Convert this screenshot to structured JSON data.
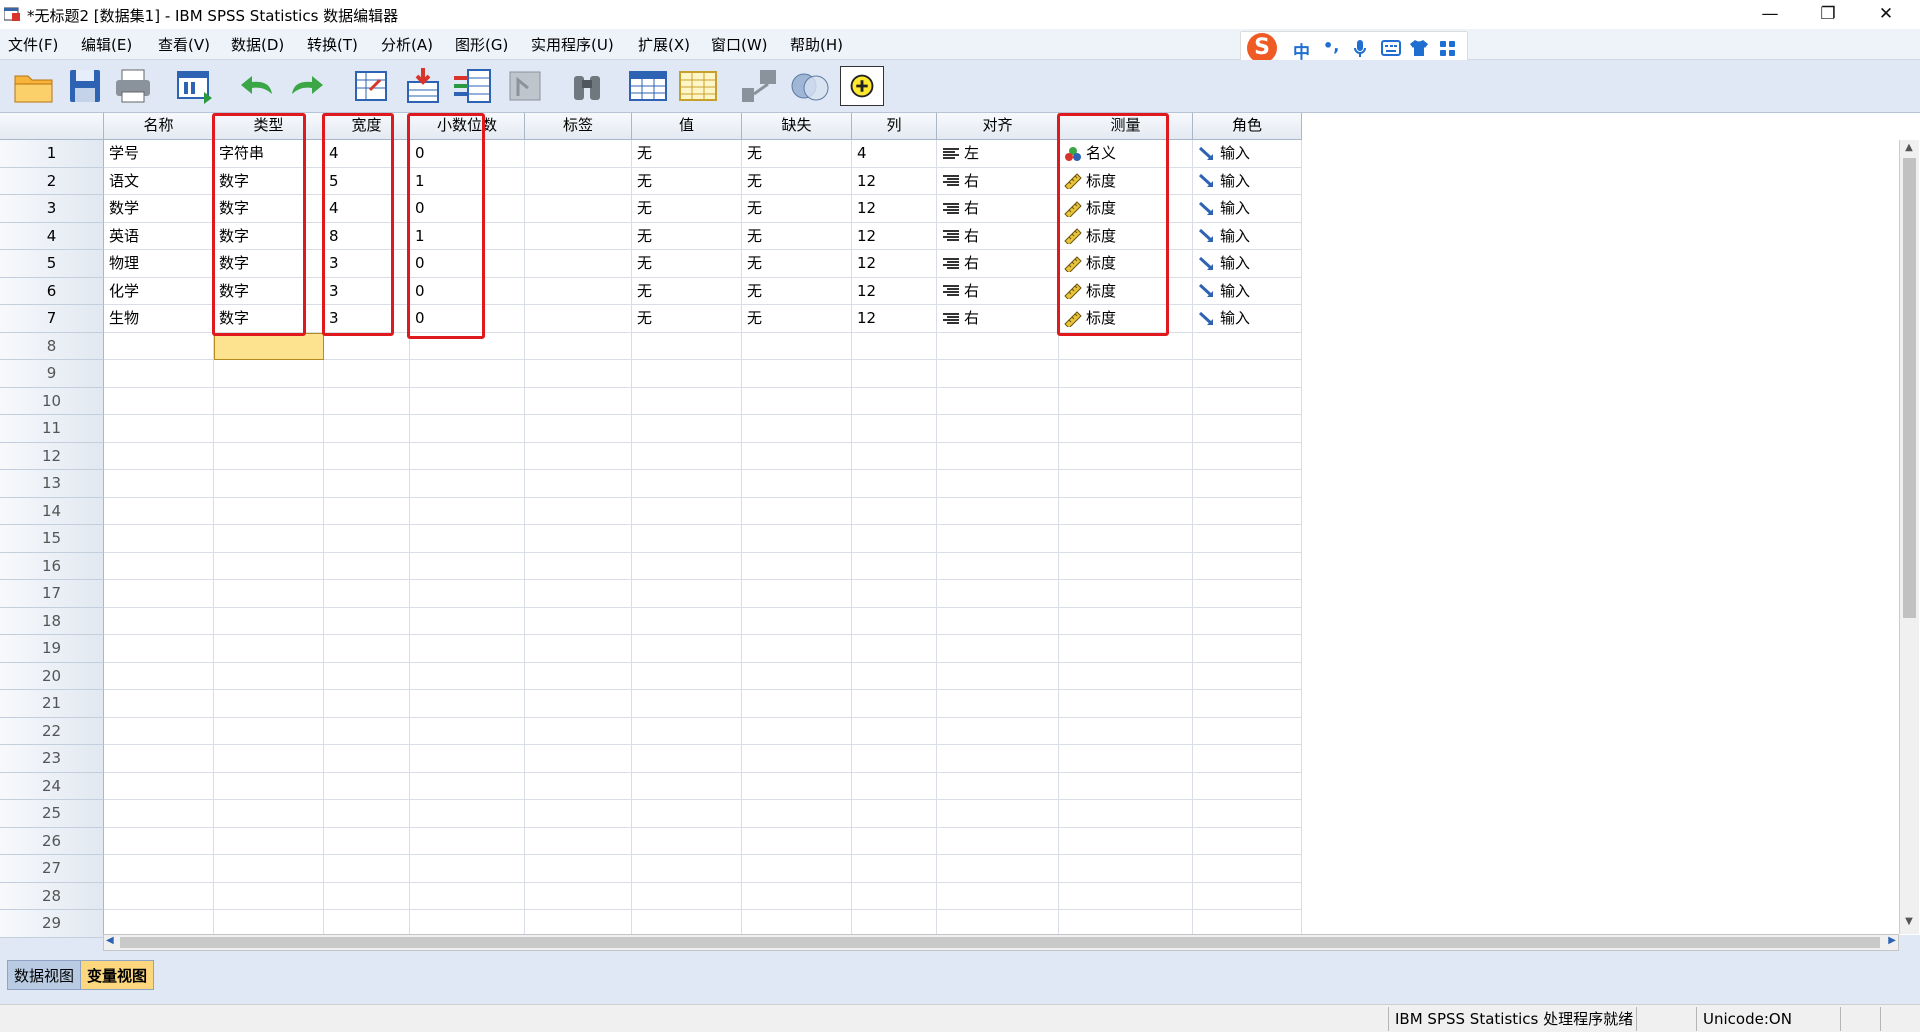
{
  "window": {
    "title": "*无标题2 [数据集1] - IBM SPSS Statistics 数据编辑器",
    "minimize": "—",
    "restore": "❐",
    "close": "✕"
  },
  "menu": [
    "文件(F)",
    "编辑(E)",
    "查看(V)",
    "数据(D)",
    "转换(T)",
    "分析(A)",
    "图形(G)",
    "实用程序(U)",
    "扩展(X)",
    "窗口(W)",
    "帮助(H)"
  ],
  "ime": {
    "logo": "S",
    "mode": "中",
    "punct": "•,"
  },
  "toolbar_icons": [
    "open-folder-icon",
    "save-icon",
    "print-icon",
    "recall-dialog-icon",
    "undo-icon",
    "redo-icon",
    "goto-case-icon",
    "goto-variable-icon",
    "variables-icon",
    "run-descriptives-icon",
    "find-icon",
    "insert-cases-icon",
    "insert-variable-icon",
    "split-file-icon",
    "weight-cases-icon",
    "select-cases-icon",
    "value-labels-icon"
  ],
  "grid": {
    "columns": [
      "名称",
      "类型",
      "宽度",
      "小数位数",
      "标签",
      "值",
      "缺失",
      "列",
      "对齐",
      "测量",
      "角色"
    ],
    "rows": [
      {
        "num": "1",
        "name": "学号",
        "type": "字符串",
        "width": "4",
        "decimals": "0",
        "label": "",
        "values": "无",
        "missing": "无",
        "columns": "4",
        "align": "左",
        "measure": "名义",
        "role": "输入"
      },
      {
        "num": "2",
        "name": "语文",
        "type": "数字",
        "width": "5",
        "decimals": "1",
        "label": "",
        "values": "无",
        "missing": "无",
        "columns": "12",
        "align": "右",
        "measure": "标度",
        "role": "输入"
      },
      {
        "num": "3",
        "name": "数学",
        "type": "数字",
        "width": "4",
        "decimals": "0",
        "label": "",
        "values": "无",
        "missing": "无",
        "columns": "12",
        "align": "右",
        "measure": "标度",
        "role": "输入"
      },
      {
        "num": "4",
        "name": "英语",
        "type": "数字",
        "width": "8",
        "decimals": "1",
        "label": "",
        "values": "无",
        "missing": "无",
        "columns": "12",
        "align": "右",
        "measure": "标度",
        "role": "输入"
      },
      {
        "num": "5",
        "name": "物理",
        "type": "数字",
        "width": "3",
        "decimals": "0",
        "label": "",
        "values": "无",
        "missing": "无",
        "columns": "12",
        "align": "右",
        "measure": "标度",
        "role": "输入"
      },
      {
        "num": "6",
        "name": "化学",
        "type": "数字",
        "width": "3",
        "decimals": "0",
        "label": "",
        "values": "无",
        "missing": "无",
        "columns": "12",
        "align": "右",
        "measure": "标度",
        "role": "输入"
      },
      {
        "num": "7",
        "name": "生物",
        "type": "数字",
        "width": "3",
        "decimals": "0",
        "label": "",
        "values": "无",
        "missing": "无",
        "columns": "12",
        "align": "右",
        "measure": "标度",
        "role": "输入"
      }
    ],
    "empty_rows": [
      "8",
      "9",
      "10",
      "11",
      "12",
      "13",
      "14",
      "15",
      "16",
      "17",
      "18",
      "19",
      "20",
      "21",
      "22",
      "23",
      "24",
      "25",
      "26",
      "27",
      "28",
      "29"
    ],
    "selected_cell": {
      "row": "8",
      "column": "类型"
    }
  },
  "tabs": [
    {
      "label": "数据视图",
      "active": false
    },
    {
      "label": "变量视图",
      "active": true
    }
  ],
  "status": {
    "processor": "IBM SPSS Statistics 处理程序就绪",
    "unicode": "Unicode:ON"
  },
  "colors": {
    "highlight_box": "#e0191f",
    "selected_cell": "#fde290",
    "active_tab": "#fcd77e",
    "inactive_tab": "#b8cbe3"
  }
}
